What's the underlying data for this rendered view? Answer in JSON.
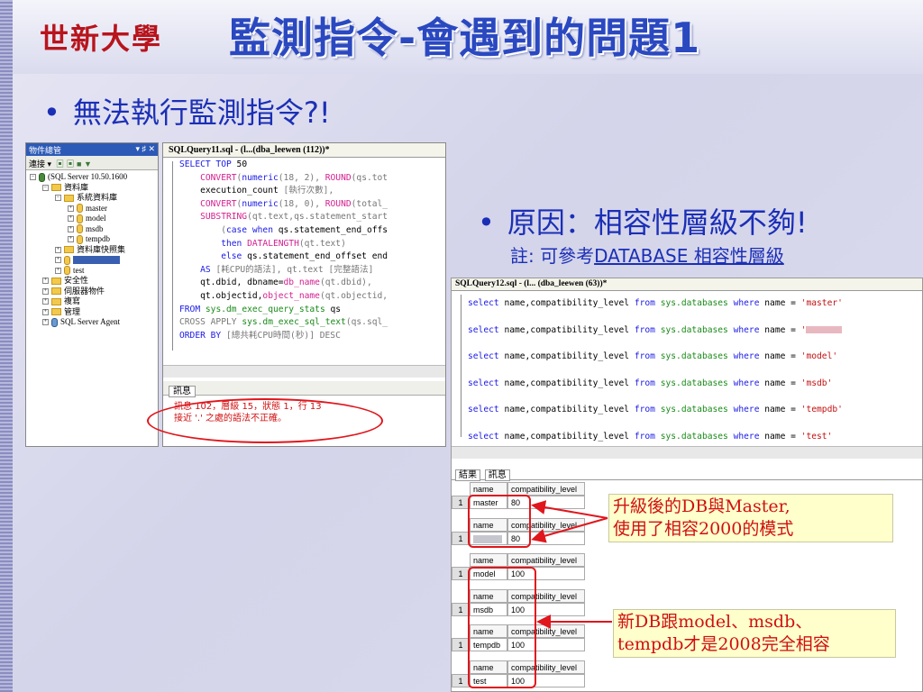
{
  "slide": {
    "logo": "世新大學",
    "title": "監測指令-會遇到的問題1",
    "bullet1": "無法執行監測指令?!",
    "bullet2": "原因：相容性層級不夠!",
    "note_prefix": "註: 可參考",
    "note_link": "DATABASE 相容性層級"
  },
  "object_explorer": {
    "title": "物件總管",
    "title_controls": "▾ ♯ ✕",
    "toolbar_connect": "連接 ▾",
    "tree": [
      {
        "label": "(SQL Server 10.50.1600",
        "level": 0,
        "icon": "server-icon",
        "expander": "−"
      },
      {
        "label": "資料庫",
        "level": 1,
        "icon": "folder-icon",
        "expander": "−"
      },
      {
        "label": "系統資料庫",
        "level": 2,
        "icon": "folder-icon",
        "expander": "−"
      },
      {
        "label": "master",
        "level": 3,
        "icon": "database-icon",
        "expander": "+"
      },
      {
        "label": "model",
        "level": 3,
        "icon": "database-icon",
        "expander": "+"
      },
      {
        "label": "msdb",
        "level": 3,
        "icon": "database-icon",
        "expander": "+"
      },
      {
        "label": "tempdb",
        "level": 3,
        "icon": "database-icon",
        "expander": "+"
      },
      {
        "label": "資料庫快照集",
        "level": 2,
        "icon": "folder-icon",
        "expander": "+"
      },
      {
        "label": "",
        "level": 2,
        "icon": "database-icon",
        "expander": "+",
        "redacted": true
      },
      {
        "label": "test",
        "level": 2,
        "icon": "database-icon",
        "expander": "+"
      },
      {
        "label": "安全性",
        "level": 1,
        "icon": "folder-icon",
        "expander": "+"
      },
      {
        "label": "伺服器物件",
        "level": 1,
        "icon": "folder-icon",
        "expander": "+"
      },
      {
        "label": "複寫",
        "level": 1,
        "icon": "folder-icon",
        "expander": "+"
      },
      {
        "label": "管理",
        "level": 1,
        "icon": "folder-icon",
        "expander": "+"
      },
      {
        "label": "SQL Server Agent",
        "level": 1,
        "icon": "agent-icon",
        "expander": "+"
      }
    ]
  },
  "query1": {
    "tab": "SQLQuery11.sql - (l...(dba_leewen (112))*",
    "lines": [
      [
        [
          "kw",
          "SELECT TOP "
        ],
        [
          "",
          "50"
        ]
      ],
      [
        [
          "fn",
          "    CONVERT"
        ],
        [
          "gr",
          "("
        ],
        [
          "kw",
          "numeric"
        ],
        [
          "gr",
          "(18, 2), "
        ],
        [
          "fn",
          "ROUND"
        ],
        [
          "gr",
          "(qs.tot"
        ]
      ],
      [
        [
          "",
          "    execution_count "
        ],
        [
          "gr",
          "[執行次數],"
        ]
      ],
      [
        [
          "fn",
          "    CONVERT"
        ],
        [
          "gr",
          "("
        ],
        [
          "kw",
          "numeric"
        ],
        [
          "gr",
          "(18, 0), "
        ],
        [
          "fn",
          "ROUND"
        ],
        [
          "gr",
          "(total_"
        ]
      ],
      [
        [
          "fn",
          "    SUBSTRING"
        ],
        [
          "gr",
          "(qt.text,qs.statement_start"
        ]
      ],
      [
        [
          "gr",
          "        ("
        ],
        [
          "kw",
          "case when "
        ],
        [
          "",
          "qs.statement_end_offs"
        ]
      ],
      [
        [
          "kw",
          "        then "
        ],
        [
          "fn",
          "DATALENGTH"
        ],
        [
          "gr",
          "(qt.text)"
        ]
      ],
      [
        [
          "kw",
          "        else "
        ],
        [
          "",
          "qs.statement_end_offset end"
        ]
      ],
      [
        [
          "kw",
          "    AS "
        ],
        [
          "gr",
          "[耗CPU的語法], qt.text [完整語法]"
        ]
      ],
      [
        [
          "",
          "    qt.dbid, dbname="
        ],
        [
          "fn",
          "db_name"
        ],
        [
          "gr",
          "(qt.dbid),"
        ]
      ],
      [
        [
          "",
          "    qt.objectid,"
        ],
        [
          "fn",
          "object_name"
        ],
        [
          "gr",
          "(qt.objectid,"
        ]
      ],
      [
        [
          "kw",
          "FROM "
        ],
        [
          "sys",
          "sys.dm_exec_query_stats "
        ],
        [
          "",
          "qs"
        ]
      ],
      [
        [
          "gr",
          "CROSS APPLY "
        ],
        [
          "sys",
          "sys.dm_exec_sql_text"
        ],
        [
          "gr",
          "(qs.sql_"
        ]
      ],
      [
        [
          "kw",
          "ORDER BY "
        ],
        [
          "gr",
          "[總共耗CPU時間(秒)] DESC"
        ]
      ]
    ],
    "msg_tab": "訊息",
    "msg_line1": "訊息 102，層級 15，狀態 1，行 13",
    "msg_line2": "接近 '.' 之處的語法不正確。"
  },
  "query2": {
    "tab": "SQLQuery12.sql - (l... (dba_leewen (63))*",
    "select_prefix": "select name,compatibility_level from sys.databases where name = ",
    "names": [
      "'master'",
      "'",
      "'model'",
      "'msdb'",
      "'tempdb'",
      "'test'"
    ],
    "tab_results": "結果",
    "tab_messages": "訊息",
    "col_name": "name",
    "col_level": "compatibility_level",
    "rows": [
      {
        "num": "1",
        "name": "master",
        "level": "80"
      },
      {
        "num": "1",
        "name": "",
        "level": "80",
        "redacted": true
      },
      {
        "num": "1",
        "name": "model",
        "level": "100"
      },
      {
        "num": "1",
        "name": "msdb",
        "level": "100"
      },
      {
        "num": "1",
        "name": "tempdb",
        "level": "100"
      },
      {
        "num": "1",
        "name": "test",
        "level": "100"
      }
    ]
  },
  "callouts": {
    "c1_line1": "升級後的DB與Master,",
    "c1_line2": "使用了相容2000的模式",
    "c2_line1": "新DB跟model、msdb、",
    "c2_line2": "tempdb才是2008完全相容"
  },
  "colors": {
    "title": "#2a48c0",
    "bullet": "#1b2fb6",
    "callout_text": "#d01010",
    "callout_bg": "#ffffcc",
    "highlight": "#e0161c"
  }
}
